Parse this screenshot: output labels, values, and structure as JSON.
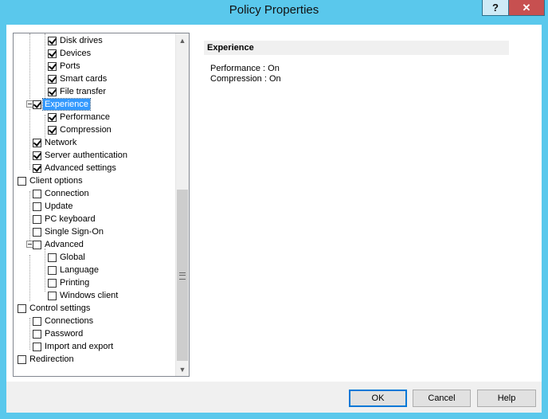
{
  "window": {
    "title": "Policy Properties",
    "help_button": "?",
    "close_button": "✕"
  },
  "tree": {
    "items": [
      {
        "label": "Disk drives",
        "checked": true
      },
      {
        "label": "Devices",
        "checked": true
      },
      {
        "label": "Ports",
        "checked": true
      },
      {
        "label": "Smart cards",
        "checked": true
      },
      {
        "label": "File transfer",
        "checked": true
      },
      {
        "label": "Experience",
        "checked": true,
        "selected": true,
        "expanded": true
      },
      {
        "label": "Performance",
        "checked": true
      },
      {
        "label": "Compression",
        "checked": true
      },
      {
        "label": "Network",
        "checked": true
      },
      {
        "label": "Server authentication",
        "checked": true
      },
      {
        "label": "Advanced settings",
        "checked": true
      },
      {
        "label": "Client options",
        "checked": false
      },
      {
        "label": "Connection",
        "checked": false
      },
      {
        "label": "Update",
        "checked": false
      },
      {
        "label": "PC keyboard",
        "checked": false
      },
      {
        "label": "Single Sign-On",
        "checked": false
      },
      {
        "label": "Advanced",
        "checked": false,
        "expanded": true
      },
      {
        "label": "Global",
        "checked": false
      },
      {
        "label": "Language",
        "checked": false
      },
      {
        "label": "Printing",
        "checked": false
      },
      {
        "label": "Windows client",
        "checked": false
      },
      {
        "label": "Control settings",
        "checked": false
      },
      {
        "label": "Connections",
        "checked": false
      },
      {
        "label": "Password",
        "checked": false
      },
      {
        "label": "Import and export",
        "checked": false
      },
      {
        "label": "Redirection",
        "checked": false
      }
    ]
  },
  "details": {
    "header": "Experience",
    "properties": [
      "Performance : On",
      "Compression : On"
    ]
  },
  "buttons": {
    "ok": "OK",
    "cancel": "Cancel",
    "help": "Help"
  },
  "colors": {
    "title_bar": "#5ac8ec",
    "selection": "#3399ff",
    "close_button": "#c75050"
  }
}
